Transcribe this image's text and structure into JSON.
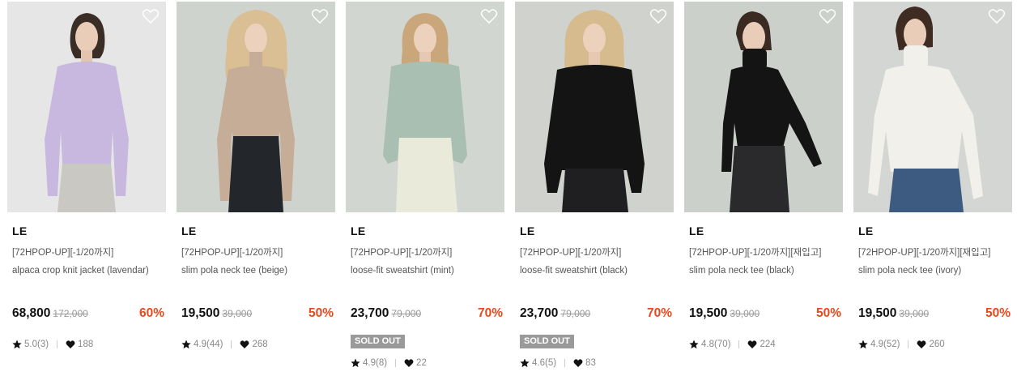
{
  "products": [
    {
      "brand": "LE",
      "promo": "[72HPOP-UP][-1/20까지]",
      "name": "alpaca crop knit jacket (lavendar)",
      "price": "68,800",
      "original_price": "172,000",
      "discount": "60%",
      "sold_out": false,
      "sold_out_label": "",
      "rating": "5.0(3)",
      "likes": "188",
      "bg": "#e6e6e6",
      "top_color": "#c8b8e0",
      "bottom_color": "#c9c8c2",
      "hair": "#3a2d26"
    },
    {
      "brand": "LE",
      "promo": "[72HPOP-UP][-1/20까지]",
      "name": "slim pola neck tee (beige)",
      "price": "19,500",
      "original_price": "39,000",
      "discount": "50%",
      "sold_out": false,
      "sold_out_label": "",
      "rating": "4.9(44)",
      "likes": "268",
      "bg": "#cfd3ce",
      "top_color": "#c6ad98",
      "bottom_color": "#23262b",
      "hair": "#d9bf93"
    },
    {
      "brand": "LE",
      "promo": "[72HPOP-UP][-1/20까지]",
      "name": "loose-fit sweatshirt (mint)",
      "price": "23,700",
      "original_price": "79,000",
      "discount": "70%",
      "sold_out": true,
      "sold_out_label": "SOLD OUT",
      "rating": "4.9(8)",
      "likes": "22",
      "bg": "#d2d6d1",
      "top_color": "#a9bfb2",
      "bottom_color": "#e9ead9",
      "hair": "#c9a77b"
    },
    {
      "brand": "LE",
      "promo": "[72HPOP-UP][-1/20까지]",
      "name": "loose-fit sweatshirt (black)",
      "price": "23,700",
      "original_price": "79,000",
      "discount": "70%",
      "sold_out": true,
      "sold_out_label": "SOLD OUT",
      "rating": "4.6(5)",
      "likes": "83",
      "bg": "#cfd2cd",
      "top_color": "#141414",
      "bottom_color": "#1f1f22",
      "hair": "#d6bb8f"
    },
    {
      "brand": "LE",
      "promo": "[72HPOP-UP][-1/20까지][재입고]",
      "name": "slim pola neck tee (black)",
      "price": "19,500",
      "original_price": "39,000",
      "discount": "50%",
      "sold_out": false,
      "sold_out_label": "",
      "rating": "4.8(70)",
      "likes": "224",
      "bg": "#ccd0cb",
      "top_color": "#141414",
      "bottom_color": "#2a2a2c",
      "hair": "#3b2a22"
    },
    {
      "brand": "LE",
      "promo": "[72HPOP-UP][-1/20까지][재입고]",
      "name": "slim pola neck tee (ivory)",
      "price": "19,500",
      "original_price": "39,000",
      "discount": "50%",
      "sold_out": false,
      "sold_out_label": "",
      "rating": "4.9(52)",
      "likes": "260",
      "bg": "#d3d6d2",
      "top_color": "#f1f0ea",
      "bottom_color": "#3d5a80",
      "hair": "#3e2c22"
    }
  ],
  "colors": {
    "discount": "#e8481c",
    "sold_out_bg": "#9a9a9a"
  },
  "icons": {
    "wishlist": "heart-outline-icon",
    "rating": "star-icon",
    "likes": "heart-icon"
  }
}
